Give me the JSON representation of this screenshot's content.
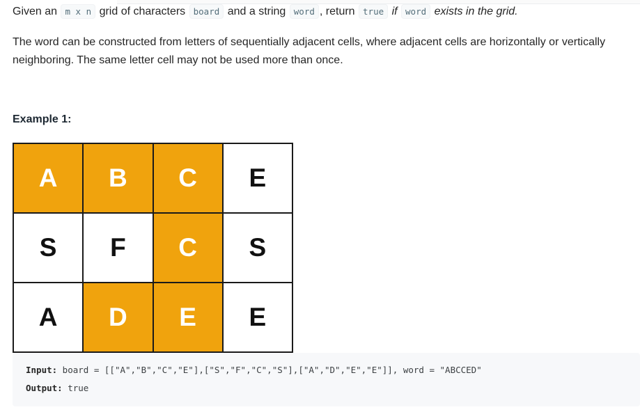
{
  "description": {
    "intro": {
      "t1": "Given an ",
      "c1": "m x n",
      "t2": " grid of characters ",
      "c2": "board",
      "t3": " and a string ",
      "c3": "word",
      "t4": ", return ",
      "c4": "true",
      "t5": " if ",
      "c5": "word",
      "t6": " exists in the grid."
    },
    "paragraph2": "The word can be constructed from letters of sequentially adjacent cells, where adjacent cells are horizontally or vertically neighboring. The same letter cell may not be used more than once."
  },
  "example": {
    "heading": "Example 1:",
    "board": [
      [
        {
          "letter": "A",
          "highlighted": true
        },
        {
          "letter": "B",
          "highlighted": true
        },
        {
          "letter": "C",
          "highlighted": true
        },
        {
          "letter": "E",
          "highlighted": false
        }
      ],
      [
        {
          "letter": "S",
          "highlighted": false
        },
        {
          "letter": "F",
          "highlighted": false
        },
        {
          "letter": "C",
          "highlighted": true
        },
        {
          "letter": "S",
          "highlighted": false
        }
      ],
      [
        {
          "letter": "A",
          "highlighted": false
        },
        {
          "letter": "D",
          "highlighted": true
        },
        {
          "letter": "E",
          "highlighted": true
        },
        {
          "letter": "E",
          "highlighted": false
        }
      ]
    ],
    "input_label": "Input:",
    "input_value": " board = [[\"A\",\"B\",\"C\",\"E\"],[\"S\",\"F\",\"C\",\"S\"],[\"A\",\"D\",\"E\",\"E\"]], word = \"ABCCED\"",
    "output_label": "Output:",
    "output_value": " true"
  },
  "colors": {
    "highlight": "#f0a30d",
    "highlight_text": "#ffffff",
    "plain_cell": "#ffffff",
    "plain_text": "#111111"
  }
}
